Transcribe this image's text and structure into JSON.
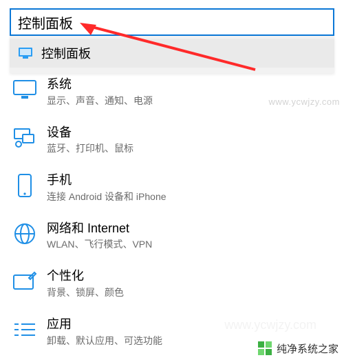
{
  "search": {
    "value": "控制面板"
  },
  "suggestion": {
    "label": "控制面板"
  },
  "categories": [
    {
      "id": "system",
      "title": "系统",
      "sub": "显示、声音、通知、电源"
    },
    {
      "id": "devices",
      "title": "设备",
      "sub": "蓝牙、打印机、鼠标"
    },
    {
      "id": "phone",
      "title": "手机",
      "sub": "连接 Android 设备和 iPhone"
    },
    {
      "id": "network",
      "title": "网络和 Internet",
      "sub": "WLAN、飞行模式、VPN"
    },
    {
      "id": "personal",
      "title": "个性化",
      "sub": "背景、锁屏、颜色"
    },
    {
      "id": "apps",
      "title": "应用",
      "sub": "卸载、默认应用、可选功能"
    }
  ],
  "watermarks": {
    "top_right": "www.ycwjzy.com",
    "brand": "纯净系统之家",
    "brand_url": "www.ycwjzy.com"
  },
  "colors": {
    "accent": "#0a77d6",
    "icon": "#1f8fe6",
    "arrow": "#ff2a2a"
  }
}
